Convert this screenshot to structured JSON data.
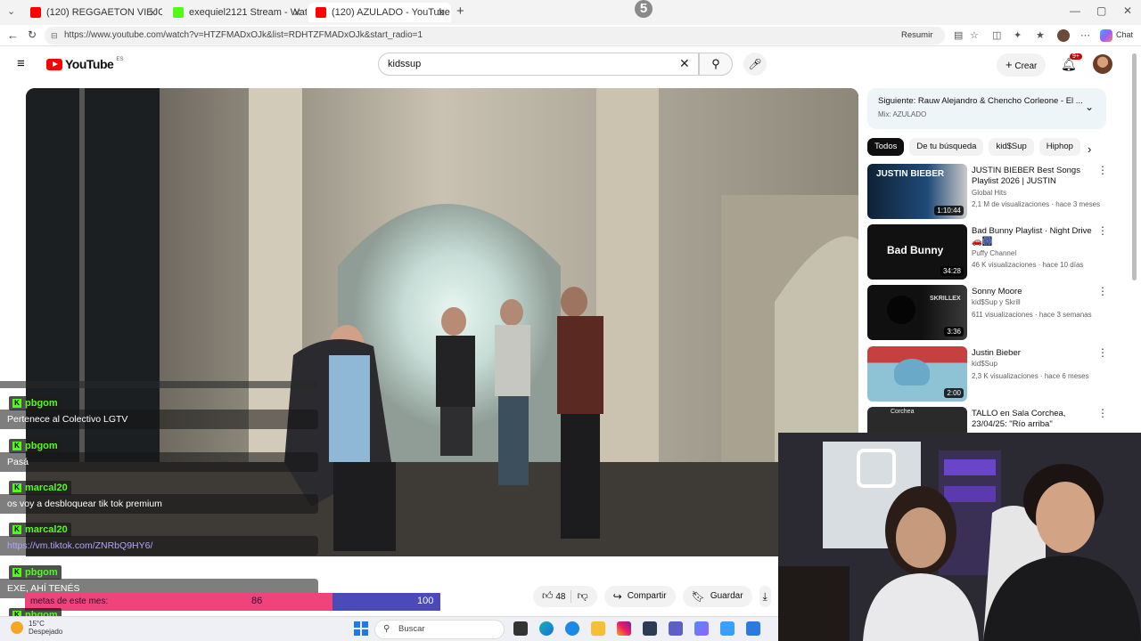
{
  "browser": {
    "tabs": [
      {
        "label": "(120) REGGAETON VIEJO Old Scho",
        "favicon_color": "#ff0000"
      },
      {
        "label": "exequiel2121 Stream - Watch Live",
        "favicon_color": "#53fc18"
      },
      {
        "label": "(120) AZULADO - YouTube",
        "favicon_color": "#ff0000"
      }
    ],
    "new_tab": "+",
    "tab_count_overlay": "5",
    "url": "https://www.youtube.com/watch?v=HTZFMADxOJk&list=RDHTZFMADxOJk&start_radio=1",
    "resume_label": "Resumir",
    "chat_label": "Chat",
    "window_controls": [
      "—",
      "▢",
      "✕"
    ]
  },
  "youtube": {
    "logo_text": "YouTube",
    "logo_region": "ES",
    "search_value": "kidssup",
    "create_label": "Crear",
    "notifications_badge": "9+",
    "brand_red": "#ff0000"
  },
  "video_actions": {
    "likes": "48",
    "share_label": "Compartir",
    "save_label": "Guardar"
  },
  "up_next": {
    "title": "Siguiente: Rauw Alejandro & Chencho Corleone - El ...",
    "subtitle": "Mix: AZULADO"
  },
  "chips": [
    "Todos",
    "De tu búsqueda",
    "kid$Sup",
    "Hiphop"
  ],
  "recommendations": [
    {
      "title": "JUSTIN BIEBER Best Songs Playlist 2026 | JUSTIN BIEBER...",
      "channel": "Global Hits",
      "meta": "2,1 M de visualizaciones · hace 3 meses",
      "duration": "1:10:44",
      "thumb_text": "JUSTIN BIEBER",
      "thumb_color": "#1b3a5c"
    },
    {
      "title": "Bad Bunny Playlist · Night Drive 🚗🎆",
      "channel": "Puffy Channel",
      "meta": "46 K visualizaciones · hace 10 días",
      "duration": "34:28",
      "thumb_text": "Bad Bunny",
      "thumb_color": "#111111"
    },
    {
      "title": "Sonny Moore",
      "channel": "kid$Sup y Skrill",
      "meta": "611 visualizaciones · hace 3 semanas",
      "duration": "3:36",
      "thumb_text": "SKRILLEX",
      "thumb_color": "#1a1a1a"
    },
    {
      "title": "Justin Bieber",
      "channel": "kid$Sup",
      "meta": "2,3 K visualizaciones · hace 6 meses",
      "duration": "2:00",
      "thumb_text": "",
      "thumb_color": "#7fb3c9"
    },
    {
      "title": "TALLO en Sala Corchea, 23/04/25: \"Río arriba\"",
      "channel": "",
      "meta": "",
      "duration": "",
      "thumb_text": "Corchea",
      "thumb_color": "#2a2a2a"
    }
  ],
  "chat": [
    {
      "user": "pbgom",
      "message": "Pertenece al Colectivo LGTV"
    },
    {
      "user": "pbgom",
      "message": "Pasá"
    },
    {
      "user": "marcal20",
      "message": "os voy a desbloquear tik tok premium"
    },
    {
      "user": "marcal20",
      "message": "https://vm.tiktok.com/ZNRbQ9HY6/"
    },
    {
      "user": "pbgom",
      "message": "EXE, AHÍ TENÉS"
    },
    {
      "user": "pbgom",
      "message": ""
    }
  ],
  "chat_colors": {
    "username": "#53fc18",
    "link": "#b2a4ff"
  },
  "goal": {
    "label": "metas de este mes:",
    "current": "86",
    "target": "100",
    "progress": 0.86,
    "fill_color": "#f0437c",
    "bg_color": "#4a4ab8"
  },
  "taskbar": {
    "weather_line1": "15°C",
    "weather_line2": "Despejado",
    "search_placeholder": "Buscar"
  }
}
